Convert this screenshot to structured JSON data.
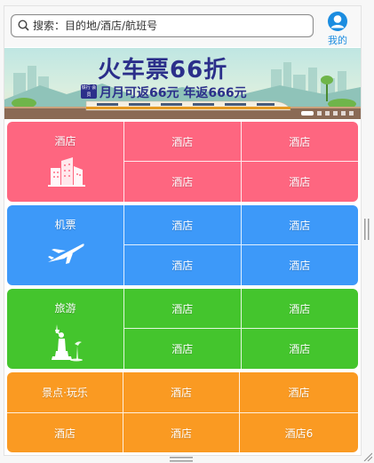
{
  "search": {
    "placeholder": "搜索：目的地/酒店/航班号"
  },
  "header": {
    "mine_label": "我的",
    "mine_icon": "user-avatar-icon"
  },
  "banner": {
    "title": "火车票66折",
    "subtitle": "月月可返66元 年返666元",
    "badge": "铁行 会员",
    "dots_total": 6,
    "active_dot": 0
  },
  "categories": [
    {
      "label": "酒店",
      "icon": "hotel-building-icon",
      "color": "#fe6680",
      "cells": [
        "酒店",
        "酒店",
        "酒店",
        "酒店"
      ]
    },
    {
      "label": "机票",
      "icon": "airplane-icon",
      "color": "#3d99f9",
      "cells": [
        "酒店",
        "酒店",
        "酒店",
        "酒店"
      ]
    },
    {
      "label": "旅游",
      "icon": "statue-of-liberty-icon",
      "color": "#44c52d",
      "cells": [
        "酒店",
        "酒店",
        "酒店",
        "酒店"
      ]
    }
  ],
  "last_category": {
    "color": "#fa9a22",
    "row1": [
      "景点·玩乐",
      "酒店",
      "酒店"
    ],
    "row2": [
      "酒店",
      "酒店",
      "酒店6"
    ]
  }
}
